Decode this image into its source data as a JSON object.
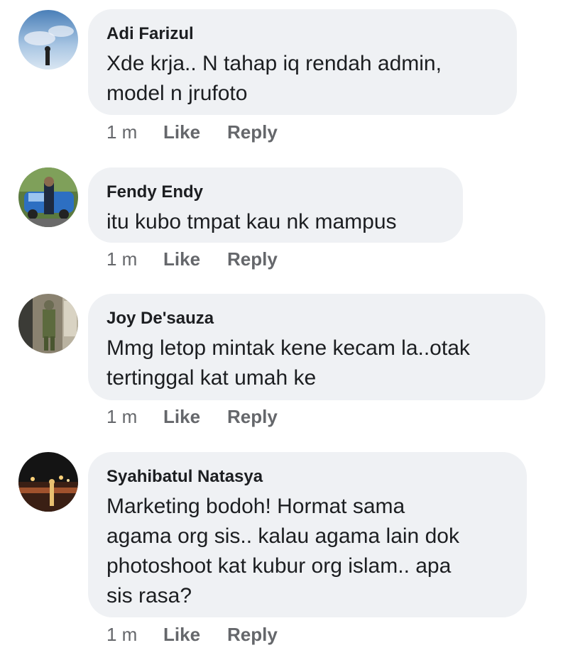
{
  "comments": [
    {
      "author": "Adi Farizul",
      "text": "Xde krja..  N tahap iq rendah admin,\nmodel n jrufoto",
      "time": "1 m",
      "like": "Like",
      "reply": "Reply"
    },
    {
      "author": "Fendy Endy",
      "text": "itu kubo tmpat kau nk mampus",
      "time": "1 m",
      "like": "Like",
      "reply": "Reply"
    },
    {
      "author": "Joy De'sauza",
      "text": "Mmg letop mintak kene kecam la..otak\ntertinggal kat umah ke",
      "time": "1 m",
      "like": "Like",
      "reply": "Reply"
    },
    {
      "author": "Syahibatul Natasya",
      "text": "Marketing bodoh! Hormat sama\nagama org sis.. kalau agama lain dok\nphotoshoot kat kubur org islam.. apa\nsis rasa?",
      "time": "1 m",
      "like": "Like",
      "reply": "Reply"
    }
  ]
}
